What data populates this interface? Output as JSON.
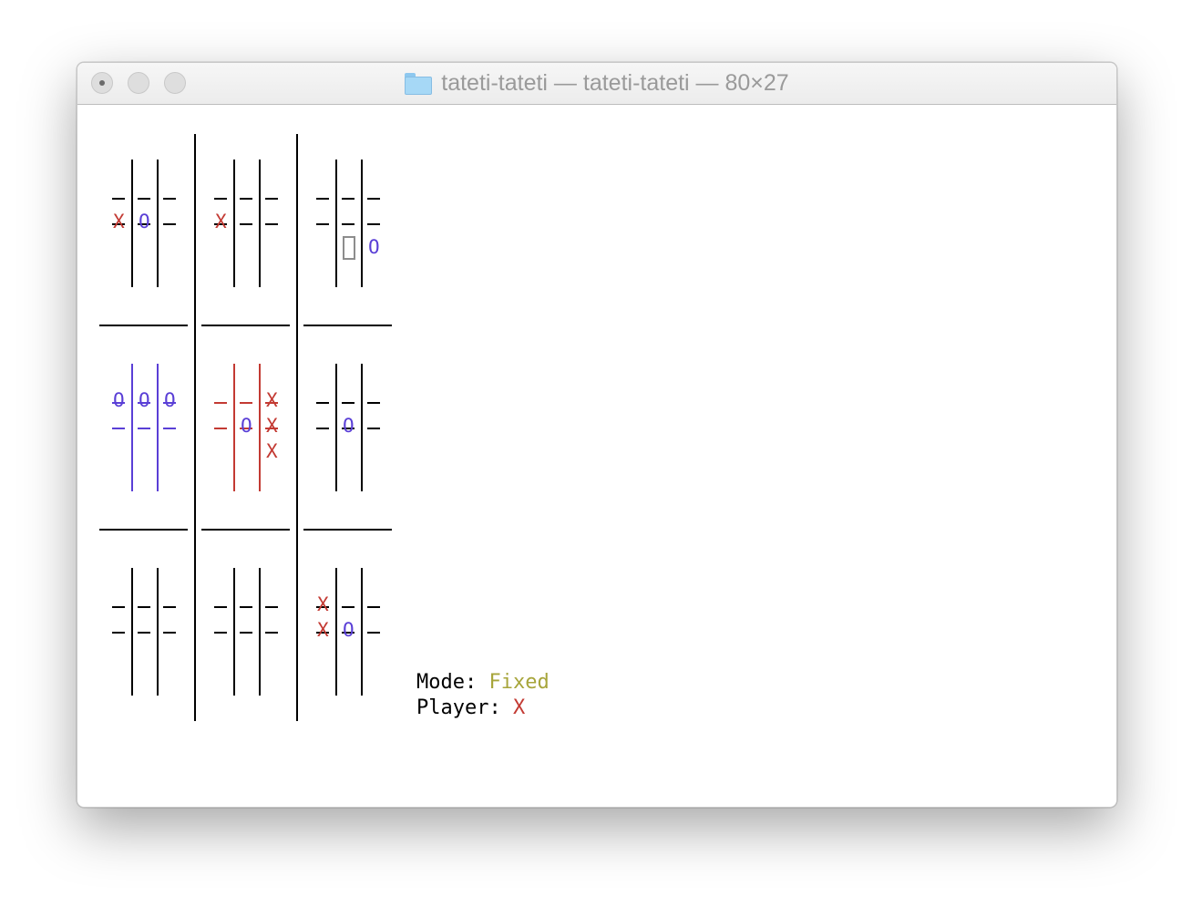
{
  "window": {
    "title": "tateti-tateti — tateti-tateti — 80×27",
    "folder_icon": "folder-icon"
  },
  "colors": {
    "x": "#c33a33",
    "o": "#5a3fd6",
    "neutral": "#000000",
    "mode": "#a7a53b",
    "cursor": "#8d8d8d"
  },
  "boards": [
    {
      "name": "top-left",
      "winner": null,
      "cells": [
        "",
        "",
        "",
        "X",
        "O",
        "",
        "",
        "",
        ""
      ]
    },
    {
      "name": "top-center",
      "winner": null,
      "cells": [
        "",
        "",
        "",
        "X",
        "",
        "",
        "",
        "",
        ""
      ]
    },
    {
      "name": "top-right",
      "winner": null,
      "cells": [
        "",
        "",
        "",
        "",
        "",
        "",
        "",
        "",
        "O"
      ],
      "cursor_cell": 7
    },
    {
      "name": "middle-left",
      "winner": "O",
      "cells": [
        "O",
        "O",
        "O",
        "",
        "",
        "",
        "",
        "",
        ""
      ]
    },
    {
      "name": "center",
      "winner": "X",
      "cells": [
        "",
        "",
        "X",
        "",
        "O",
        "X",
        "",
        "",
        "X"
      ]
    },
    {
      "name": "middle-right",
      "winner": null,
      "cells": [
        "",
        "",
        "",
        "",
        "O",
        "",
        "",
        "",
        ""
      ]
    },
    {
      "name": "bottom-left",
      "winner": null,
      "cells": [
        "",
        "",
        "",
        "",
        "",
        "",
        "",
        "",
        ""
      ]
    },
    {
      "name": "bottom-center",
      "winner": null,
      "cells": [
        "",
        "",
        "",
        "",
        "",
        "",
        "",
        "",
        ""
      ]
    },
    {
      "name": "bottom-right",
      "winner": null,
      "cells": [
        "X",
        "",
        "",
        "X",
        "O",
        "",
        "",
        "",
        ""
      ]
    }
  ],
  "status": {
    "mode_label": "Mode: ",
    "mode_value": "Fixed",
    "player_label": "Player: ",
    "player_value": "X"
  }
}
